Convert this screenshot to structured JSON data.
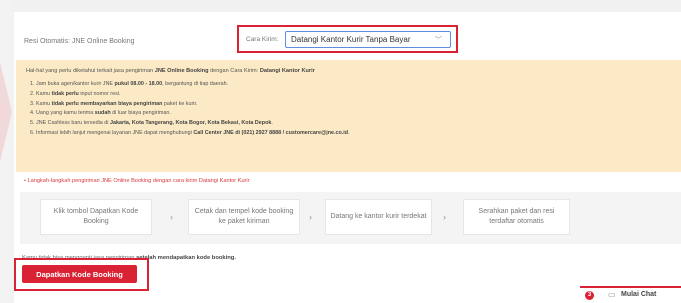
{
  "header": {
    "resi_label": "Resi Otomatis: JNE Online Booking",
    "cara_kirim_label": "Cara Kirim:",
    "cara_kirim_value": "Datangi Kantor Kurir Tanpa Bayar"
  },
  "info": {
    "title_prefix": "Hal-hal yang perlu diketahui terkait jasa pengiriman ",
    "title_bold_1": "JNE Online Booking",
    "title_mid": " dengan Cara Kirim: ",
    "title_bold_2": "Datangi Kantor Kurir",
    "items": [
      {
        "a": "1. Jam buka agen/kantor kurir JNE ",
        "b": "pukul 08.00 - 18.00",
        "c": ", bergantung di tiap daerah.",
        "d": "",
        "e": ""
      },
      {
        "a": "2. Kamu ",
        "b": "tidak perlu",
        "c": " input nomor resi.",
        "d": "",
        "e": ""
      },
      {
        "a": "3. Kamu ",
        "b": "tidak perlu membayarkan biaya pengiriman",
        "c": " paket ke kurir.",
        "d": "",
        "e": ""
      },
      {
        "a": "4. Uang yang kamu terima ",
        "b": "sudah",
        "c": " di luar biaya pengiriman.",
        "d": "",
        "e": ""
      },
      {
        "a": "5. JNE Cashless baru tersedia di ",
        "b": "Jakarta, Kota Tangerang, Kota Bogor, Kota Bekasi, Kota Depok",
        "c": ".",
        "d": "",
        "e": ""
      },
      {
        "a": "6. Informasi lebih lanjut mengenai layanan JNE dapat menghubungi ",
        "b": "Call Center JNE di (021) 2927 8888 / customercare@jne.co.id",
        "c": ".",
        "d": "",
        "e": ""
      }
    ]
  },
  "steps": {
    "heading": "Langkah-langkah pengiriman JNE Online Booking dengan cara kirim Datangi Kantor Kurir",
    "items": [
      "Klik tombol Dapatkan Kode Booking",
      "Cetak dan tempel kode booking ke paket kiriman",
      "Datang ke kantor kurir terdekat",
      "Serahkan paket dan resi terdaftar otomatis"
    ],
    "separator": "›"
  },
  "note": {
    "prefix": "Kamu tidak bisa mengganti jasa pengiriman ",
    "bold": "setelah mendapatkan kode booking."
  },
  "button": {
    "label": "Dapatkan Kode Booking"
  },
  "chat": {
    "badge": "3",
    "label": "Mulai Chat"
  },
  "colors": {
    "accent": "#d92233",
    "info_bg": "#fbeac5",
    "focus_border": "#5b8de0"
  }
}
